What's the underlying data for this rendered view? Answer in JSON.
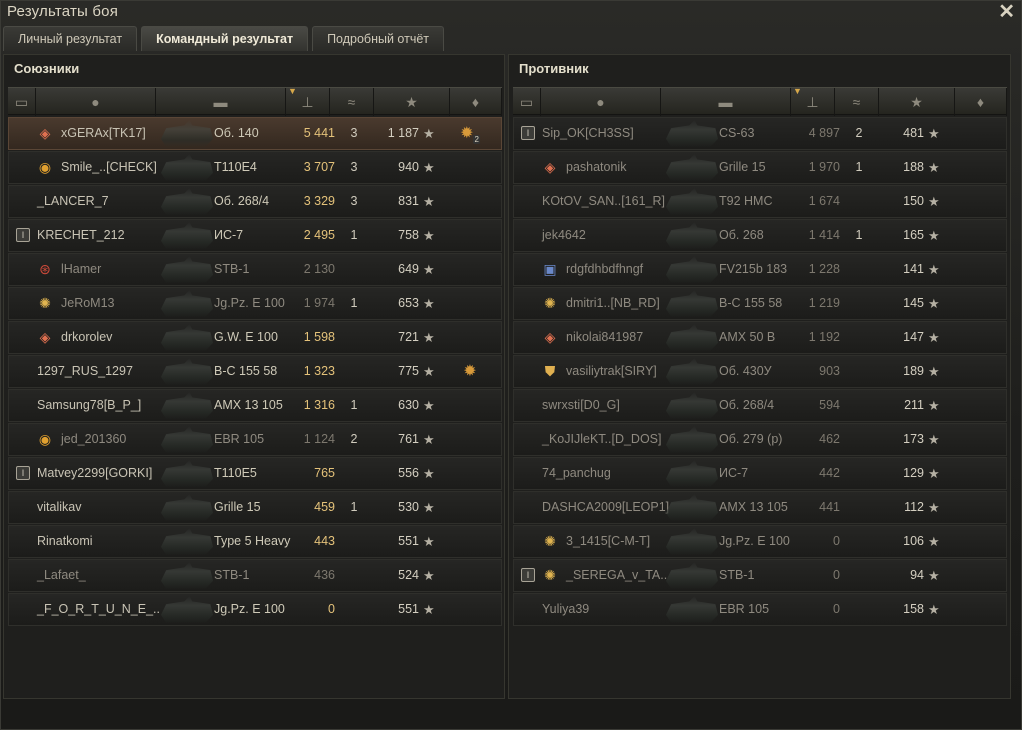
{
  "window": {
    "title": "Результаты боя",
    "tabs": [
      "Личный результат",
      "Командный результат",
      "Подробный отчёт"
    ],
    "active_tab": 1
  },
  "teams": {
    "allies": {
      "title": "Союзники",
      "players": [
        {
          "platoon": "",
          "badge": "diamond",
          "name": "xGERAx[TK17]",
          "vehicle": "Об. 140",
          "damage": "5 441",
          "kills": "3",
          "xp": "1 187",
          "medal": "medal",
          "medal_count": "2",
          "me": true,
          "dead": false,
          "dmg_style": "hi"
        },
        {
          "platoon": "",
          "badge": "ring",
          "name": "Smile_..[CHECK]",
          "vehicle": "T110E4",
          "damage": "3 707",
          "kills": "3",
          "xp": "940",
          "medal": "",
          "medal_count": "",
          "me": false,
          "dead": false,
          "dmg_style": "hi"
        },
        {
          "platoon": "",
          "badge": "",
          "name": "_LANCER_7",
          "vehicle": "Об. 268/4",
          "damage": "3 329",
          "kills": "3",
          "xp": "831",
          "medal": "",
          "medal_count": "",
          "me": false,
          "dead": false,
          "dmg_style": "hi"
        },
        {
          "platoon": "I",
          "badge": "",
          "name": "KRECHET_212",
          "vehicle": "ИС-7",
          "damage": "2 495",
          "kills": "1",
          "xp": "758",
          "medal": "",
          "medal_count": "",
          "me": false,
          "dead": false,
          "dmg_style": "hi"
        },
        {
          "platoon": "",
          "badge": "round",
          "name": "lHamer",
          "vehicle": "STB-1",
          "damage": "2 130",
          "kills": "",
          "xp": "649",
          "medal": "",
          "medal_count": "",
          "me": false,
          "dead": true,
          "dmg_style": "lo"
        },
        {
          "platoon": "",
          "badge": "gold",
          "name": "JeRoM13",
          "vehicle": "Jg.Pz. E 100",
          "damage": "1 974",
          "kills": "1",
          "xp": "653",
          "medal": "",
          "medal_count": "",
          "me": false,
          "dead": true,
          "dmg_style": "lo"
        },
        {
          "platoon": "",
          "badge": "diamond",
          "name": "drkorolev",
          "vehicle": "G.W. E 100",
          "damage": "1 598",
          "kills": "",
          "xp": "721",
          "medal": "",
          "medal_count": "",
          "me": false,
          "dead": false,
          "dmg_style": "hi"
        },
        {
          "platoon": "",
          "badge": "",
          "name": "1297_RUS_1297",
          "vehicle": "B-C 155 58",
          "damage": "1 323",
          "kills": "",
          "xp": "775",
          "medal": "medal",
          "medal_count": "",
          "me": false,
          "dead": false,
          "dmg_style": "hi"
        },
        {
          "platoon": "",
          "badge": "",
          "name": "Samsung78[B_P_]",
          "vehicle": "AMX 13 105",
          "damage": "1 316",
          "kills": "1",
          "xp": "630",
          "medal": "",
          "medal_count": "",
          "me": false,
          "dead": false,
          "dmg_style": "hi"
        },
        {
          "platoon": "",
          "badge": "ring",
          "name": "jed_201360",
          "vehicle": "EBR 105",
          "damage": "1 124",
          "kills": "2",
          "xp": "761",
          "medal": "",
          "medal_count": "",
          "me": false,
          "dead": true,
          "dmg_style": "lo"
        },
        {
          "platoon": "I",
          "badge": "",
          "name": "Matvey2299[GORKI]",
          "vehicle": "T110E5",
          "damage": "765",
          "kills": "",
          "xp": "556",
          "medal": "",
          "medal_count": "",
          "me": false,
          "dead": false,
          "dmg_style": "hi"
        },
        {
          "platoon": "",
          "badge": "",
          "name": "vitalikav",
          "vehicle": "Grille 15",
          "damage": "459",
          "kills": "1",
          "xp": "530",
          "medal": "",
          "medal_count": "",
          "me": false,
          "dead": false,
          "dmg_style": "hi"
        },
        {
          "platoon": "",
          "badge": "",
          "name": "Rinatkomi",
          "vehicle": "Type 5 Heavy",
          "damage": "443",
          "kills": "",
          "xp": "551",
          "medal": "",
          "medal_count": "",
          "me": false,
          "dead": false,
          "dmg_style": "hi"
        },
        {
          "platoon": "",
          "badge": "",
          "name": "_Lafaet_",
          "vehicle": "STB-1",
          "damage": "436",
          "kills": "",
          "xp": "524",
          "medal": "",
          "medal_count": "",
          "me": false,
          "dead": true,
          "dmg_style": "lo"
        },
        {
          "platoon": "",
          "badge": "",
          "name": "_F_O_R_T_U_N_E_..",
          "vehicle": "Jg.Pz. E 100",
          "damage": "0",
          "kills": "",
          "xp": "551",
          "medal": "",
          "medal_count": "",
          "me": false,
          "dead": false,
          "dmg_style": "hi"
        }
      ]
    },
    "enemies": {
      "title": "Противник",
      "players": [
        {
          "platoon": "I",
          "badge": "",
          "name": "Sip_OK[CH3SS]",
          "vehicle": "CS-63",
          "damage": "4 897",
          "kills": "2",
          "xp": "481",
          "medal": "",
          "medal_count": "",
          "me": false,
          "dead": true,
          "dmg_style": "lo"
        },
        {
          "platoon": "",
          "badge": "diamond",
          "name": "pashatonik",
          "vehicle": "Grille 15",
          "damage": "1 970",
          "kills": "1",
          "xp": "188",
          "medal": "",
          "medal_count": "",
          "me": false,
          "dead": true,
          "dmg_style": "lo"
        },
        {
          "platoon": "",
          "badge": "",
          "name": "KOtOV_SAN..[161_R]",
          "vehicle": "T92 HMC",
          "damage": "1 674",
          "kills": "",
          "xp": "150",
          "medal": "",
          "medal_count": "",
          "me": false,
          "dead": true,
          "dmg_style": "lo"
        },
        {
          "platoon": "",
          "badge": "",
          "name": "jek4642",
          "vehicle": "Об. 268",
          "damage": "1 414",
          "kills": "1",
          "xp": "165",
          "medal": "",
          "medal_count": "",
          "me": false,
          "dead": true,
          "dmg_style": "lo"
        },
        {
          "platoon": "",
          "badge": "box",
          "name": "rdgfdhbdfhngf",
          "vehicle": "FV215b 183",
          "damage": "1 228",
          "kills": "",
          "xp": "141",
          "medal": "",
          "medal_count": "",
          "me": false,
          "dead": true,
          "dmg_style": "lo"
        },
        {
          "platoon": "",
          "badge": "gold",
          "name": "dmitri1..[NB_RD]",
          "vehicle": "B-C 155 58",
          "damage": "1 219",
          "kills": "",
          "xp": "145",
          "medal": "",
          "medal_count": "",
          "me": false,
          "dead": true,
          "dmg_style": "lo"
        },
        {
          "platoon": "",
          "badge": "diamond",
          "name": "nikolai841987",
          "vehicle": "AMX 50 B",
          "damage": "1 192",
          "kills": "",
          "xp": "147",
          "medal": "",
          "medal_count": "",
          "me": false,
          "dead": true,
          "dmg_style": "lo"
        },
        {
          "platoon": "",
          "badge": "shield",
          "name": "vasiliytrak[SIRY]",
          "vehicle": "Об. 430У",
          "damage": "903",
          "kills": "",
          "xp": "189",
          "medal": "",
          "medal_count": "",
          "me": false,
          "dead": true,
          "dmg_style": "lo"
        },
        {
          "platoon": "",
          "badge": "",
          "name": "swrxsti[D0_G]",
          "vehicle": "Об. 268/4",
          "damage": "594",
          "kills": "",
          "xp": "211",
          "medal": "",
          "medal_count": "",
          "me": false,
          "dead": true,
          "dmg_style": "lo"
        },
        {
          "platoon": "",
          "badge": "",
          "name": "_KoJIJleKT..[D_DOS]",
          "vehicle": "Об. 279 (р)",
          "damage": "462",
          "kills": "",
          "xp": "173",
          "medal": "",
          "medal_count": "",
          "me": false,
          "dead": true,
          "dmg_style": "lo"
        },
        {
          "platoon": "",
          "badge": "",
          "name": "74_panchug",
          "vehicle": "ИС-7",
          "damage": "442",
          "kills": "",
          "xp": "129",
          "medal": "",
          "medal_count": "",
          "me": false,
          "dead": true,
          "dmg_style": "lo"
        },
        {
          "platoon": "",
          "badge": "",
          "name": "DASHCA2009[LEOP1]",
          "vehicle": "AMX 13 105",
          "damage": "441",
          "kills": "",
          "xp": "112",
          "medal": "",
          "medal_count": "",
          "me": false,
          "dead": true,
          "dmg_style": "lo"
        },
        {
          "platoon": "",
          "badge": "gold",
          "name": "3_1415[C-M-T]",
          "vehicle": "Jg.Pz. E 100",
          "damage": "0",
          "kills": "",
          "xp": "106",
          "medal": "",
          "medal_count": "",
          "me": false,
          "dead": true,
          "dmg_style": "lo"
        },
        {
          "platoon": "I",
          "badge": "gold",
          "name": "_SEREGA_v_TA..",
          "vehicle": "STB-1",
          "damage": "0",
          "kills": "",
          "xp": "94",
          "medal": "",
          "medal_count": "",
          "me": false,
          "dead": true,
          "dmg_style": "lo"
        },
        {
          "platoon": "",
          "badge": "",
          "name": "Yuliya39",
          "vehicle": "EBR 105",
          "damage": "0",
          "kills": "",
          "xp": "158",
          "medal": "",
          "medal_count": "",
          "me": false,
          "dead": true,
          "dmg_style": "lo"
        }
      ]
    }
  },
  "colors": {
    "damage_highlight": "#e4c27a",
    "damage_dim": "#7d786e",
    "self_row": "#4a3a2e",
    "medal": "#d89a3a"
  },
  "icons": {
    "close": "close-icon",
    "header": [
      "platoon-icon",
      "player-icon",
      "tank-icon",
      "damage-icon",
      "kills-icon",
      "xp-star-icon",
      "medal-icon"
    ]
  }
}
